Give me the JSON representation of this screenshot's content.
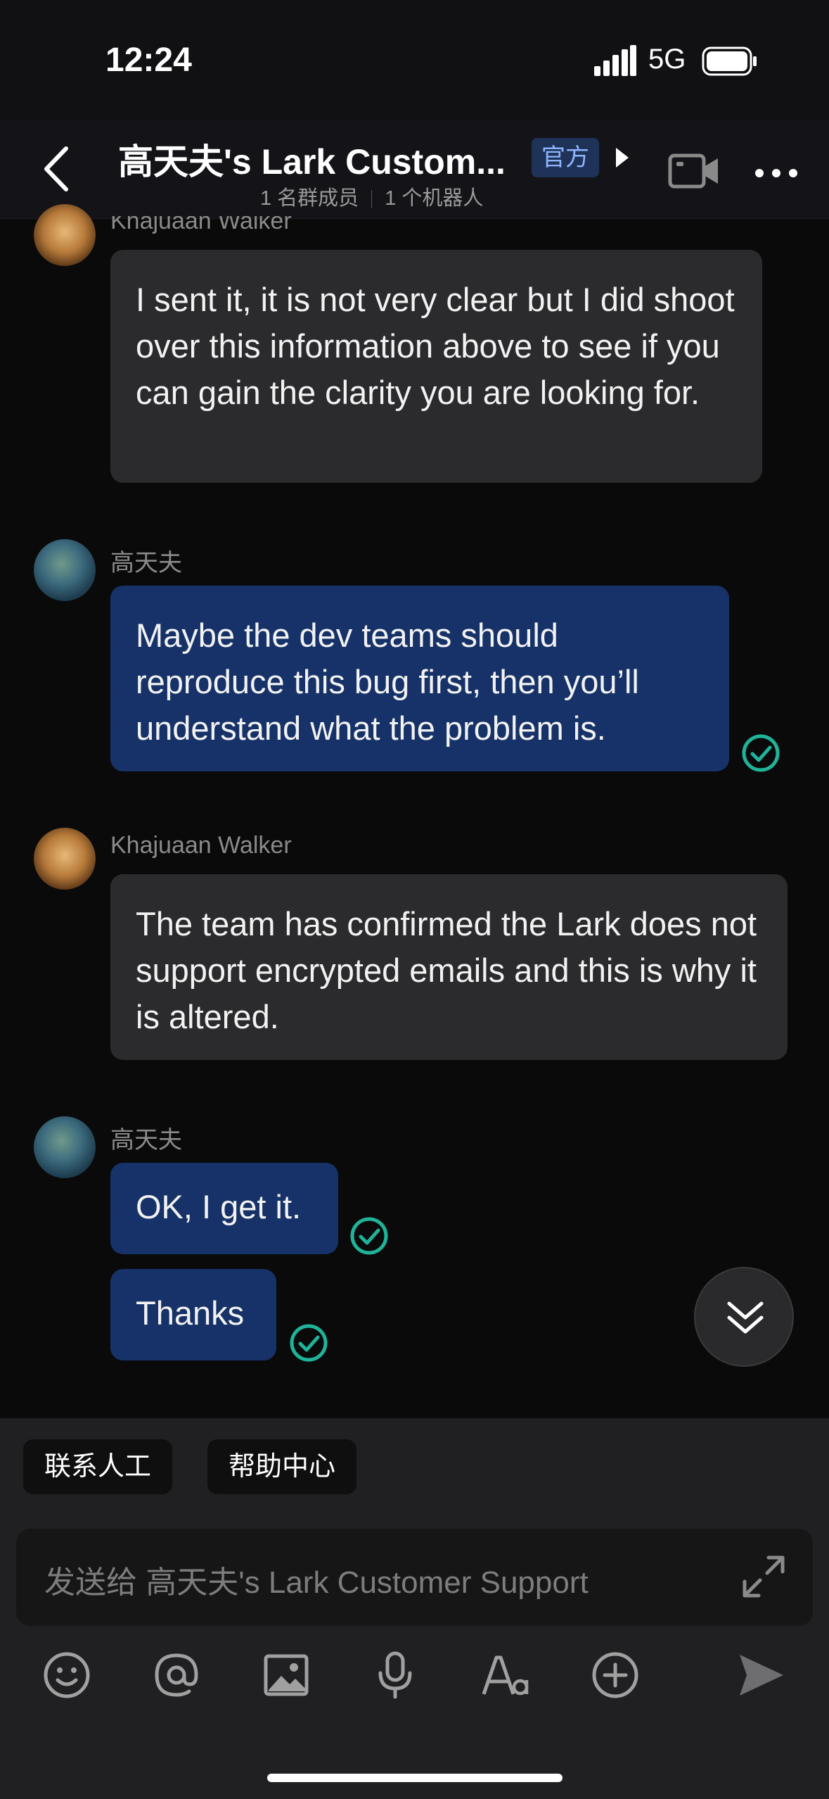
{
  "status_bar": {
    "time": "12:24",
    "network": "5G"
  },
  "header": {
    "title": "高天夫's Lark Custom...",
    "official_badge": "官方",
    "member_count": "1 名群成员",
    "bot_count": "1 个机器人"
  },
  "messages": [
    {
      "sender": "Khajuaan Walker",
      "text": "I sent it, it is not very clear but I did shoot over this information above to see if you can gain the clarity you are looking for."
    },
    {
      "sender": "高天夫",
      "text": "Maybe the dev teams should reproduce this bug first, then you’ll understand what the problem is."
    },
    {
      "sender": "Khajuaan Walker",
      "text": "The team has confirmed the Lark does not support encrypted emails and this is why it is altered."
    },
    {
      "sender": "高天夫",
      "text": "OK, I get it."
    },
    {
      "text": "Thanks"
    }
  ],
  "quick_actions": [
    "联系人工",
    "帮助中心"
  ],
  "composer": {
    "placeholder": "发送给 高天夫's Lark Customer Support"
  },
  "toolbar_icons": [
    "emoji-icon",
    "mention-icon",
    "image-icon",
    "microphone-icon",
    "text-format-icon",
    "add-icon",
    "send-icon"
  ],
  "colors": {
    "accent_blue_bubble": "#163268",
    "read_check": "#1fb39a",
    "background": "#0a0a0a"
  }
}
